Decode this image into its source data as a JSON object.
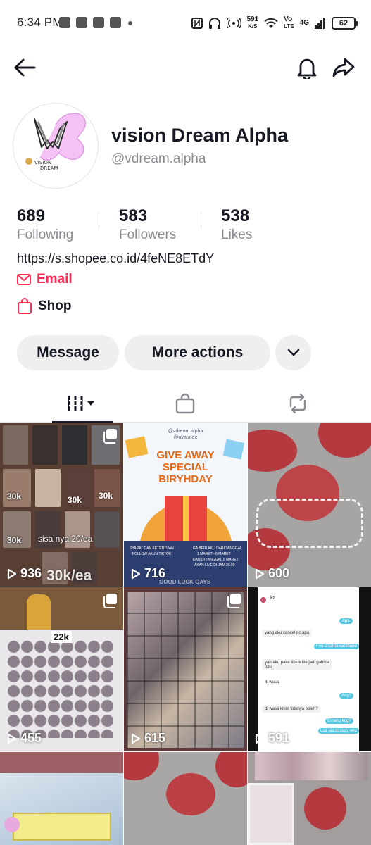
{
  "status_bar": {
    "time": "6:34 PM",
    "net_speed_value": "591",
    "net_speed_unit": "K/S",
    "volte_top": "Vo",
    "volte_bottom": "LTE",
    "network": "4G",
    "battery": "62"
  },
  "profile": {
    "display_name": "vision Dream Alpha",
    "username": "@vdream.alpha",
    "avatar_logo_text": "VISION DREAM",
    "stats": {
      "following_count": "689",
      "following_label": "Following",
      "followers_count": "583",
      "followers_label": "Followers",
      "likes_count": "538",
      "likes_label": "Likes"
    },
    "bio_link": "https://s.shopee.co.id/4feNE8ETdY",
    "email_label": "Email",
    "shop_label": "Shop"
  },
  "actions": {
    "message_label": "Message",
    "more_actions_label": "More actions"
  },
  "tabs": [
    "videos",
    "shop",
    "reposts"
  ],
  "videos": [
    {
      "views": "936",
      "overlays": [
        "30k",
        "30k",
        "30k",
        "30k",
        "sisa nya 20/ea",
        "30k/ea"
      ],
      "multi": true
    },
    {
      "views": "716",
      "overlays": [
        "@vdream.alpha",
        "@avaunee",
        "GIVE AWAY SPECIAL",
        "BIRYHDAY",
        "SYARAT DAN KETENTUAN :",
        "FOLLOW AKUN TIKTOK",
        "GA BERLAKU DARI TANGGAL",
        "1 MARET - 6 MARET",
        "DAN DI TANGGAL 6 MARET",
        "AKAN LIVE DI JAM 20.00",
        "GOOD LUCK GAYS"
      ],
      "multi": false
    },
    {
      "views": "600",
      "overlays": [],
      "multi": false
    },
    {
      "views": "455",
      "overlays": [
        "22k"
      ],
      "multi": true
    },
    {
      "views": "615",
      "overlays": [],
      "multi": true
    },
    {
      "views": "591",
      "overlays": [
        "ka",
        "Apa",
        "yang aku cancel pc apa",
        "Fmi 2 sama caratland",
        "yah aku pake tiktok lite jadi gabisa foto",
        "di wasa",
        "Ang?",
        "di wasa kirim fotonya boleh?",
        "Emang kng?",
        "Liat aja di story aku"
      ],
      "multi": false
    },
    {
      "views": "",
      "overlays": [],
      "multi": false
    },
    {
      "views": "",
      "overlays": [],
      "multi": false
    },
    {
      "views": "",
      "overlays": [],
      "multi": false
    }
  ],
  "colors": {
    "accent_red": "#fe2c55",
    "text_primary": "#161823",
    "text_secondary": "#8a8b91",
    "button_bg": "#efeff0"
  }
}
